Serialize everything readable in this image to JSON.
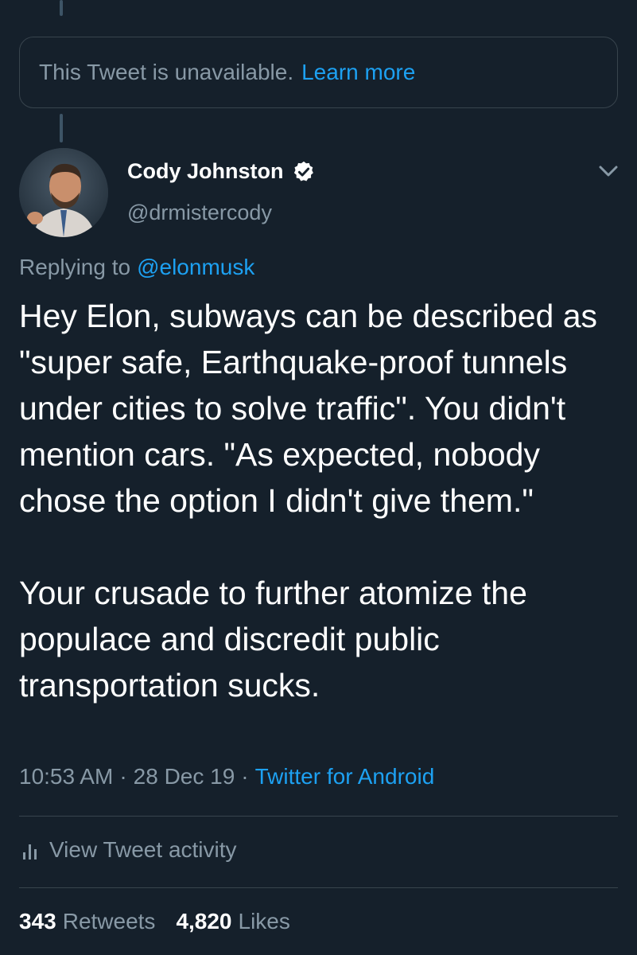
{
  "unavailable": {
    "message": "This Tweet is unavailable.",
    "learn_more": "Learn more"
  },
  "author": {
    "name": "Cody Johnston",
    "handle": "@drmistercody",
    "verified_icon": "verified-badge-icon"
  },
  "reply": {
    "prefix": "Replying to",
    "mention": "@elonmusk"
  },
  "tweet": {
    "paragraph_1": "Hey Elon, subways can be described as \"super safe, Earthquake-proof tunnels under cities to solve traffic\". You didn't mention cars. \"As expected, nobody chose the option I didn't give them.\"",
    "paragraph_2": "Your crusade to further atomize the populace and discredit public transportation sucks."
  },
  "meta": {
    "time": "10:53 AM",
    "date": "28 Dec 19",
    "separator": "·",
    "source": "Twitter for Android"
  },
  "activity": {
    "label": "View Tweet activity",
    "icon": "bar-chart-icon"
  },
  "stats": {
    "retweets_count": "343",
    "retweets_label": "Retweets",
    "likes_count": "4,820",
    "likes_label": "Likes"
  },
  "colors": {
    "background": "#15202b",
    "accent": "#1da1f2",
    "secondary_text": "#8899a6",
    "border": "#38444d"
  }
}
